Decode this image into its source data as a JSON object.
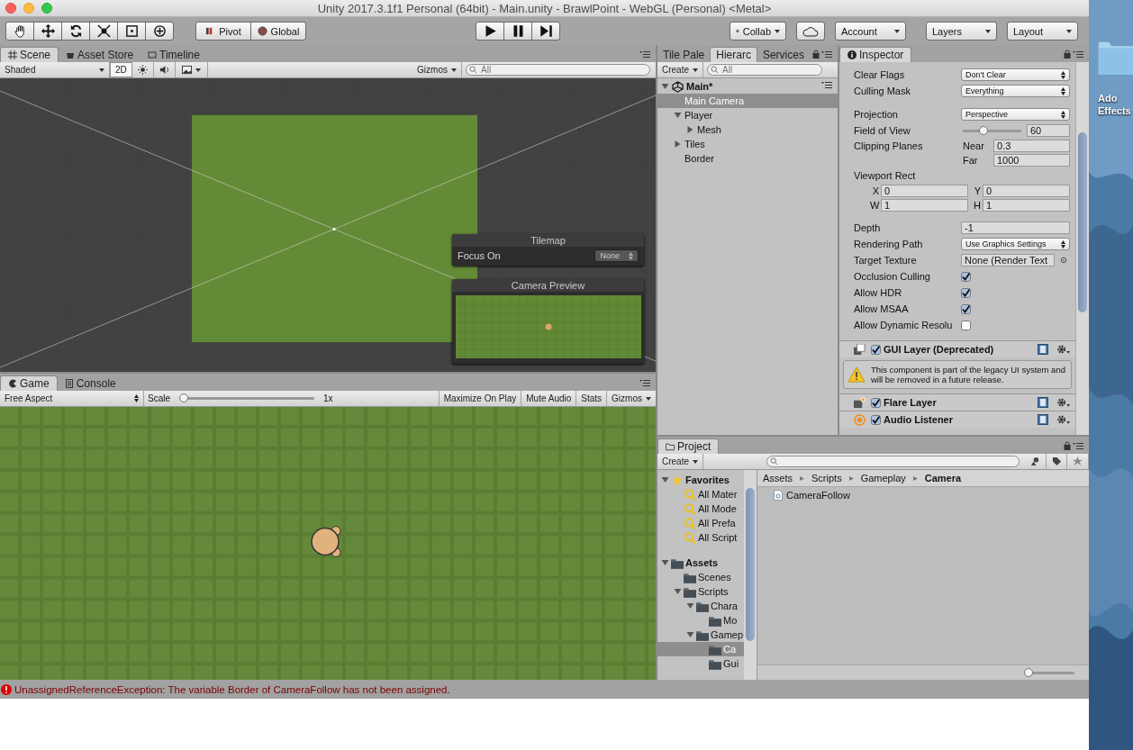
{
  "window": {
    "title": "Unity 2017.3.1f1 Personal (64bit) - Main.unity - BrawlPoint - WebGL (Personal) <Metal>"
  },
  "toolbar": {
    "pivot": [
      "Pivot",
      "Global"
    ],
    "collab": "Collab",
    "account": "Account",
    "layers": "Layers",
    "layout": "Layout"
  },
  "scene_panel": {
    "tabs": [
      {
        "label": "Scene",
        "selected": true
      },
      {
        "label": "Asset Store",
        "selected": false
      },
      {
        "label": "Timeline",
        "selected": false
      }
    ],
    "shading": "Shaded",
    "mode_2d": {
      "label": "2D",
      "on": true
    },
    "gizmos": "Gizmos",
    "search_placeholder": "All",
    "tilemap_overlay": {
      "title": "Tilemap",
      "label": "Focus On",
      "value": "None"
    },
    "camera_preview": {
      "title": "Camera Preview"
    }
  },
  "game_panel": {
    "tabs": [
      {
        "label": "Game",
        "selected": true
      },
      {
        "label": "Console",
        "selected": false
      }
    ],
    "aspect": "Free Aspect",
    "scale_label": "Scale",
    "scale": {
      "level": 0
    },
    "scale_reading": "1x",
    "buttons": [
      "Maximize On Play",
      "Mute Audio",
      "Stats",
      "Gizmos"
    ]
  },
  "hierarchy": {
    "tabs": [
      {
        "label": "Tile Pale",
        "selected": false
      },
      {
        "label": "Hierarc",
        "selected": true
      },
      {
        "label": "Services",
        "selected": false
      }
    ],
    "create": "Create",
    "search_placeholder": "All",
    "tree": [
      {
        "label": "Main*",
        "kind": "scene",
        "selected": false,
        "expanded": true,
        "children": [
          {
            "label": "Main Camera",
            "selected": true
          },
          {
            "label": "Player",
            "selected": false,
            "expanded": true,
            "children": [
              {
                "label": "Mesh",
                "selected": false,
                "expanded": false
              }
            ]
          },
          {
            "label": "Tiles",
            "selected": false,
            "expanded": false
          },
          {
            "label": "Border",
            "selected": false
          }
        ]
      }
    ]
  },
  "inspector": {
    "tab": "Inspector",
    "groups": [
      [
        {
          "kind": "dropdown",
          "label": "Clear Flags",
          "value": "Don't Clear"
        },
        {
          "kind": "dropdown",
          "label": "Culling Mask",
          "value": "Everything"
        }
      ],
      [
        {
          "kind": "dropdown",
          "label": "Projection",
          "value": "Perspective"
        },
        {
          "kind": "slider",
          "label": "Field of View",
          "level": 0.33,
          "value": "60"
        },
        {
          "kind": "planes",
          "label": "Clipping Planes",
          "fields": [
            {
              "label": "Near",
              "value": "0.3"
            },
            {
              "label": "Far",
              "value": "1000"
            }
          ]
        },
        {
          "kind": "heading",
          "label": "Viewport Rect"
        },
        {
          "kind": "pair",
          "fields": [
            {
              "label": "X",
              "value": "0"
            },
            {
              "label": "Y",
              "value": "0"
            }
          ]
        },
        {
          "kind": "pair",
          "fields": [
            {
              "label": "W",
              "value": "1"
            },
            {
              "label": "H",
              "value": "1"
            }
          ]
        }
      ],
      [
        {
          "kind": "field",
          "label": "Depth",
          "value": "-1"
        },
        {
          "kind": "dropdown",
          "label": "Rendering Path",
          "value": "Use Graphics Settings"
        },
        {
          "kind": "object",
          "label": "Target Texture",
          "value": "None (Render Text"
        },
        {
          "kind": "checkbox",
          "label": "Occlusion Culling",
          "checked": true
        },
        {
          "kind": "checkbox",
          "label": "Allow HDR",
          "checked": true
        },
        {
          "kind": "checkbox",
          "label": "Allow MSAA",
          "checked": true
        },
        {
          "kind": "checkbox",
          "label": "Allow Dynamic Resolu",
          "checked": false
        }
      ]
    ],
    "components": [
      {
        "name": "GUI Layer (Deprecated)",
        "kind": "gui",
        "enabled": true,
        "warning": "This component is part of the legacy UI system and will be removed in a future release."
      },
      {
        "name": "Flare Layer",
        "kind": "flare",
        "enabled": true
      },
      {
        "name": "Audio Listener",
        "kind": "audio",
        "enabled": true
      }
    ]
  },
  "project": {
    "tab": "Project",
    "create": "Create",
    "tree": [
      {
        "label": "Favorites",
        "kind": "favorites",
        "selected": false,
        "expanded": true,
        "children": [
          {
            "label": "All Mater",
            "kind": "search",
            "selected": false
          },
          {
            "label": "All Mode",
            "kind": "search",
            "selected": false
          },
          {
            "label": "All Prefa",
            "kind": "search",
            "selected": false
          },
          {
            "label": "All Script",
            "kind": "search",
            "selected": false
          }
        ]
      },
      {
        "label": "Assets",
        "kind": "folder",
        "selected": false,
        "expanded": true,
        "children": [
          {
            "label": "Scenes",
            "kind": "folder",
            "selected": false
          },
          {
            "label": "Scripts",
            "kind": "folder",
            "selected": false,
            "expanded": true,
            "children": [
              {
                "label": "Chara",
                "kind": "folder",
                "selected": false,
                "expanded": true,
                "children": [
                  {
                    "label": "Mo",
                    "kind": "folder",
                    "selected": false
                  }
                ]
              },
              {
                "label": "Gamep",
                "kind": "folder",
                "selected": false,
                "expanded": true,
                "children": [
                  {
                    "label": "Ca",
                    "kind": "folder",
                    "selected": true
                  },
                  {
                    "label": "Gui",
                    "kind": "folder",
                    "selected": false
                  }
                ]
              }
            ]
          }
        ]
      }
    ],
    "breadcrumb": [
      "Assets",
      "Scripts",
      "Gameplay",
      "Camera"
    ],
    "files": [
      "CameraFollow"
    ],
    "zoom": {
      "level": 0
    }
  },
  "status_bar": {
    "message": "UnassignedReferenceException: The variable Border of CameraFollow has not been assigned."
  },
  "desktop": {
    "label_lines": [
      "Ado",
      "Effects"
    ]
  }
}
